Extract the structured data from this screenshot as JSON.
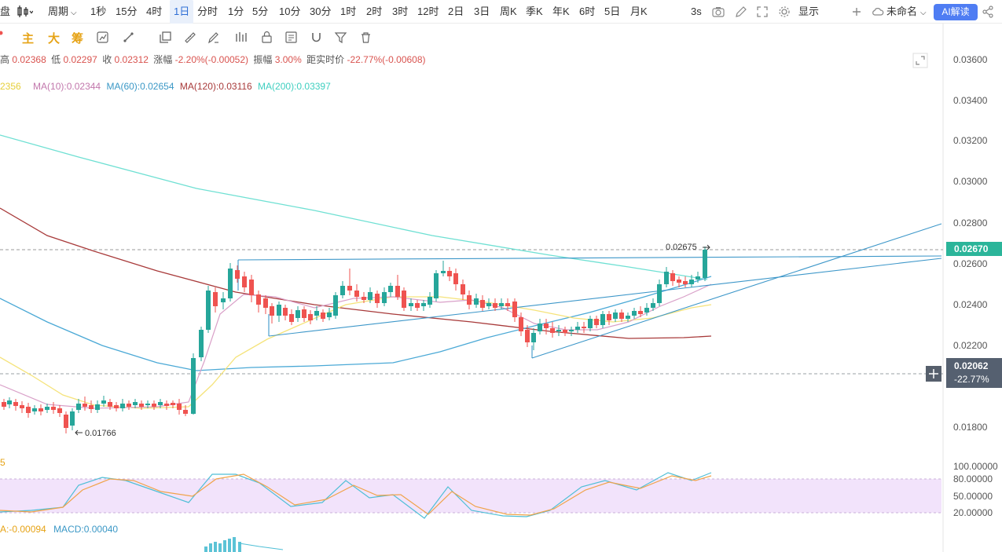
{
  "toolbar": {
    "left_cut": "盘",
    "period_label": "周期",
    "periods": [
      "1秒",
      "15分",
      "4时",
      "1日",
      "分时",
      "1分",
      "5分",
      "10分",
      "30分",
      "1时",
      "2时",
      "3时",
      "12时",
      "2日",
      "3日",
      "周K",
      "季K",
      "年K",
      "6时",
      "5日",
      "月K"
    ],
    "active_period": "1日",
    "refresh": "3s",
    "display_label": "显示",
    "unnamed_label": "未命名",
    "ai_label": "AI解读"
  },
  "tools": {
    "chars": [
      "主",
      "大",
      "筹"
    ]
  },
  "ohlc": {
    "high_label": "高",
    "high": "0.02368",
    "low_label": "低",
    "low": "0.02297",
    "close_label": "收",
    "close": "0.02312",
    "change_label": "涨幅",
    "change": "-2.20%(-0.00052)",
    "amp_label": "振幅",
    "amp": "3.00%",
    "dist_label": "距实时价",
    "dist": "-22.77%(-0.00608)"
  },
  "ma_legend": {
    "ma5_cut": "2356",
    "ma10": "MA(10):0.02344",
    "ma60": "MA(60):0.02654",
    "ma120": "MA(120):0.03116",
    "ma200": "MA(200):0.03397"
  },
  "colors": {
    "up": "#26a69a",
    "down": "#ef5350",
    "ma5": "#f5e37b",
    "ma10": "#d9a0c8",
    "ma60": "#4ba9d6",
    "ma120": "#a83a3a",
    "ma200": "#6fe0d3",
    "trend": "#3d97c9",
    "current_tag": "#2bb59a",
    "cross_tag": "#556070"
  },
  "price_axis": [
    "0.03600",
    "0.03400",
    "0.03200",
    "0.03000",
    "0.02800",
    "0.02600",
    "0.02400",
    "0.02200",
    "0.01800"
  ],
  "current_price": "0.02670",
  "crosshair": {
    "price": "0.02062",
    "pct": "-22.77%"
  },
  "high_marker": "0.02675",
  "low_marker": "0.01766",
  "kdj_cut": "5",
  "kdj_axis": [
    "100.00000",
    "80.00000",
    "50.00000",
    "20.00000"
  ],
  "macd_legend": {
    "dea_cut": "A:-0.00094",
    "macd": "MACD:0.00040"
  }
}
